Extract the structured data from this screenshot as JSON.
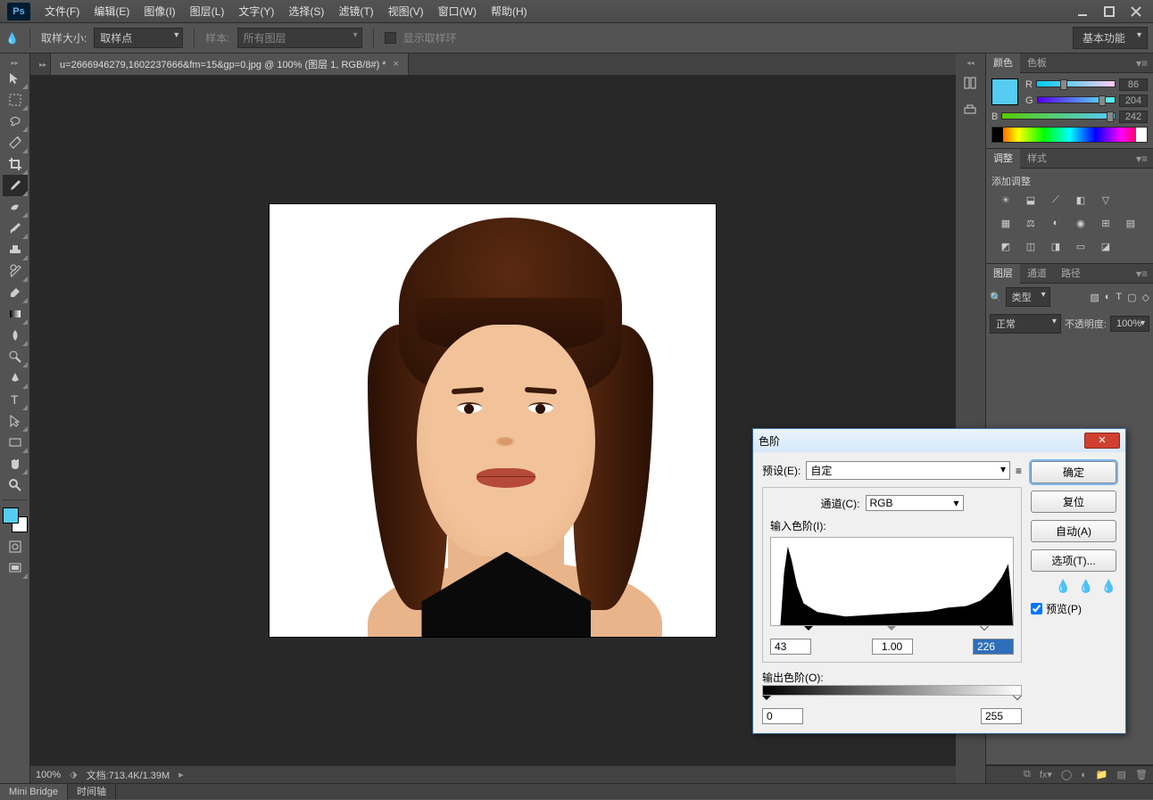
{
  "menu": [
    "文件(F)",
    "编辑(E)",
    "图像(I)",
    "图层(L)",
    "文字(Y)",
    "选择(S)",
    "滤镜(T)",
    "视图(V)",
    "窗口(W)",
    "帮助(H)"
  ],
  "optbar": {
    "sample_size_label": "取样大小:",
    "sample_size_value": "取样点",
    "sample_label": "样本:",
    "sample_value": "所有图层",
    "show_ring": "显示取样环"
  },
  "workspace": "基本功能",
  "doctab": "u=2666946279,1602237666&fm=15&gp=0.jpg @ 100% (图层 1, RGB/8#) *",
  "status": {
    "zoom": "100%",
    "docinfo": "文档:713.4K/1.39M"
  },
  "bottom_tabs": [
    "Mini Bridge",
    "时间轴"
  ],
  "color": {
    "tab1": "颜色",
    "tab2": "色板",
    "r_label": "R",
    "g_label": "G",
    "b_label": "B",
    "r": "86",
    "g": "204",
    "b": "242"
  },
  "adjust": {
    "tab1": "调整",
    "tab2": "样式",
    "title": "添加调整"
  },
  "layers": {
    "tab1": "图层",
    "tab2": "通道",
    "tab3": "路径",
    "kind": "类型",
    "blend": "正常",
    "opacity_label": "不透明度:",
    "opacity": "100%"
  },
  "dialog": {
    "title": "色阶",
    "preset_label": "预设(E):",
    "preset_value": "自定",
    "channel_label": "通道(C):",
    "channel_value": "RGB",
    "input_label": "输入色阶(I):",
    "output_label": "输出色阶(O):",
    "in_black": "43",
    "in_gamma": "1.00",
    "in_white": "226",
    "out_black": "0",
    "out_white": "255",
    "ok": "确定",
    "reset": "复位",
    "auto": "自动(A)",
    "options": "选项(T)...",
    "preview": "预览(P)"
  }
}
